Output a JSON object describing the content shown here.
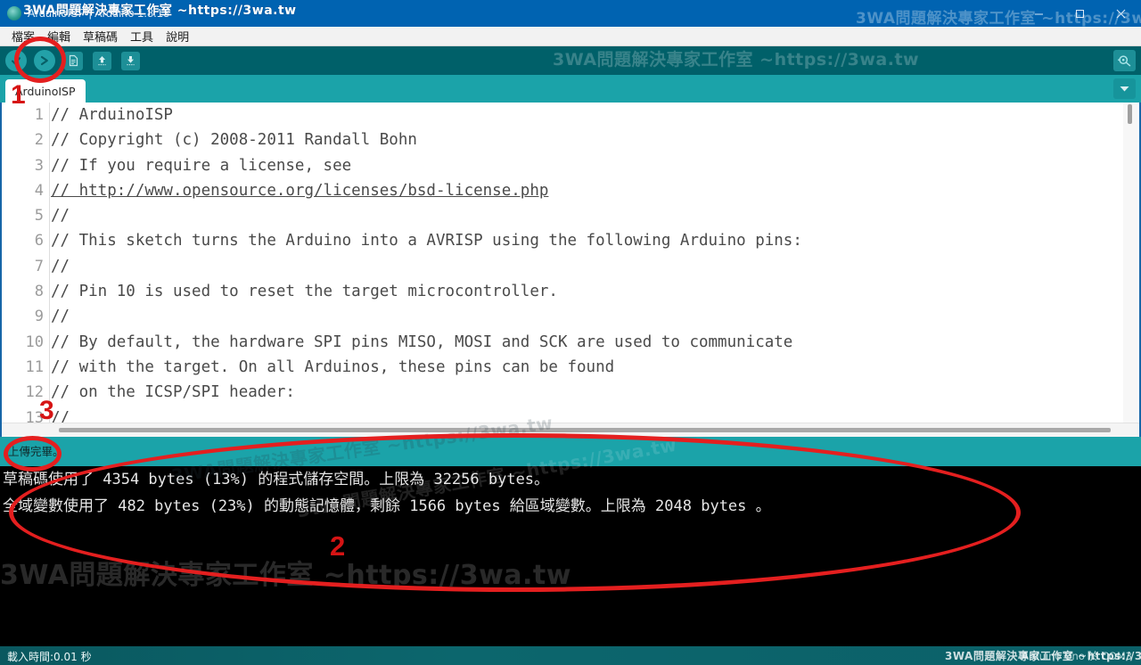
{
  "window": {
    "title": "ArduinoISP | Arduino 1.8.13",
    "minimize_label": "─",
    "maximize_label": "□",
    "close_label": "✕"
  },
  "menu": {
    "items": [
      {
        "label": "檔案"
      },
      {
        "label": "編輯"
      },
      {
        "label": "草稿碼"
      },
      {
        "label": "工具"
      },
      {
        "label": "說明"
      }
    ]
  },
  "toolbar": {
    "verify_label": "驗證",
    "upload_label": "上傳",
    "new_label": "新增",
    "open_label": "開啟",
    "save_label": "儲存",
    "serial_monitor_label": "序列埠監控視窗"
  },
  "tabs": {
    "active": "ArduinoISP",
    "items": [
      {
        "label": "ArduinoISP"
      }
    ],
    "menu_label": "▼"
  },
  "editor": {
    "lines": [
      {
        "n": "1",
        "text": "// ArduinoISP"
      },
      {
        "n": "2",
        "text": "// Copyright (c) 2008-2011 Randall Bohn"
      },
      {
        "n": "3",
        "text": "// If you require a license, see"
      },
      {
        "n": "4",
        "text": "// http://www.opensource.org/licenses/bsd-license.php",
        "link": true,
        "prefix": "// "
      },
      {
        "n": "5",
        "text": "//"
      },
      {
        "n": "6",
        "text": "// This sketch turns the Arduino into a AVRISP using the following Arduino pins:"
      },
      {
        "n": "7",
        "text": "//"
      },
      {
        "n": "8",
        "text": "// Pin 10 is used to reset the target microcontroller."
      },
      {
        "n": "9",
        "text": "//"
      },
      {
        "n": "10",
        "text": "// By default, the hardware SPI pins MISO, MOSI and SCK are used to communicate"
      },
      {
        "n": "11",
        "text": "// with the target. On all Arduinos, these pins can be found"
      },
      {
        "n": "12",
        "text": "// on the ICSP/SPI header:"
      },
      {
        "n": "13",
        "text": "//"
      }
    ]
  },
  "status": {
    "message": "上傳完畢。"
  },
  "console": {
    "lines": [
      "草稿碼使用了 4354 bytes (13%) 的程式儲存空間。上限為 32256 bytes。",
      "全域變數使用了 482 bytes (23%) 的動態記憶體，剩餘 1566 bytes 給區域變數。上限為 2048 bytes 。"
    ]
  },
  "bottom_bar": {
    "left_text": "載入時間:0.01 秒",
    "right_text": "Arduino Uno 於 COM3"
  },
  "annotations": {
    "marker_1": "1",
    "marker_2": "2",
    "marker_3": "3"
  },
  "watermark": {
    "text": "3WA問題解決專家工作室 ~https://3wa.tw"
  },
  "colors": {
    "titlebar": "#0063b1",
    "toolbar": "#006069",
    "tabstrip": "#1ba3a9",
    "console_bg": "#000000",
    "annotation_red": "#e41f1f",
    "status_bar": "#0b6068"
  }
}
